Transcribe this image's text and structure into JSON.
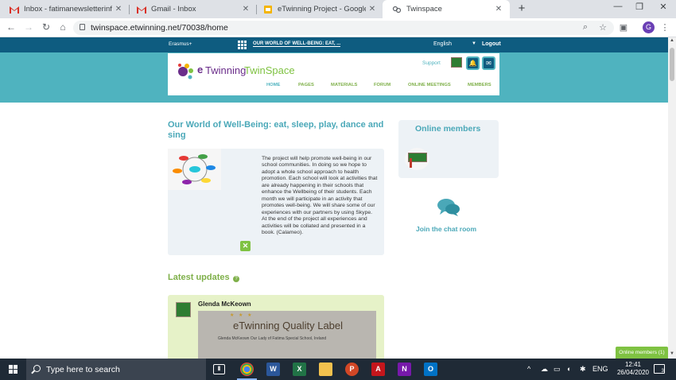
{
  "browser": {
    "tabs": [
      {
        "title": "Inbox - fatimanewsletterinfo@gm",
        "favicon": "gmail-icon",
        "close": "✕"
      },
      {
        "title": "Gmail - Inbox",
        "favicon": "gmail-icon",
        "close": "✕"
      },
      {
        "title": "eTwinning Project - Google Slide",
        "favicon": "slides-icon",
        "close": "✕"
      },
      {
        "title": "Twinspace",
        "favicon": "twinspace-icon",
        "close": "✕",
        "active": true
      }
    ],
    "new_tab": "+",
    "window": {
      "minimize": "—",
      "maximize": "❐",
      "close": "✕"
    },
    "url": "twinspace.etwinning.net/70038/home",
    "profile_initial": "G"
  },
  "site": {
    "topbar": {
      "program": "Erasmus+",
      "project_selector": "OUR WORLD OF WELL-BEING: EAT, ...",
      "language": "English",
      "logout": "Logout"
    },
    "logo": {
      "e": "e",
      "twinning": "Twinning",
      "twinspace": "TwinSpace"
    },
    "support": "Support",
    "menu": [
      "HOME",
      "PAGES",
      "MATERIALS",
      "FORUM",
      "ONLINE MEETINGS",
      "MEMBERS"
    ],
    "project_title": "Our World of Well-Being: eat, sleep, play, dance and sing",
    "project_description": "The project will help promote well-being in our school communities. In doing so we hope to adopt a whole school approach to health promotion. Each school will look at activities that are already happening in their schools that enhance the Wellbeing of their students. Each month we will participate in an activity that promotes well-being. We will share some of our experiences with our partners by using Skype. At the end of the project all experiences and activities will be collated and presented in a book. (Calameo).",
    "latest_updates": "Latest updates",
    "help": "?",
    "update": {
      "author": "Glenda McKeown",
      "image_title": "eTwinning Quality Label",
      "image_subtitle": "Glenda McKeown Our Lady of Fatima Special School, Ireland"
    },
    "online_members": {
      "title": "Online members",
      "count_chip": "Online members (1)"
    },
    "chat": {
      "label": "Join the chat room"
    }
  },
  "taskbar": {
    "search_placeholder": "Type here to search",
    "language": "ENG",
    "time": "12:41",
    "date": "26/04/2020",
    "notifications": "3"
  },
  "colors": {
    "teal": "#4fb3bf",
    "navy": "#0e5c80",
    "green": "#7fc242",
    "title_teal": "#4aa8b8"
  }
}
